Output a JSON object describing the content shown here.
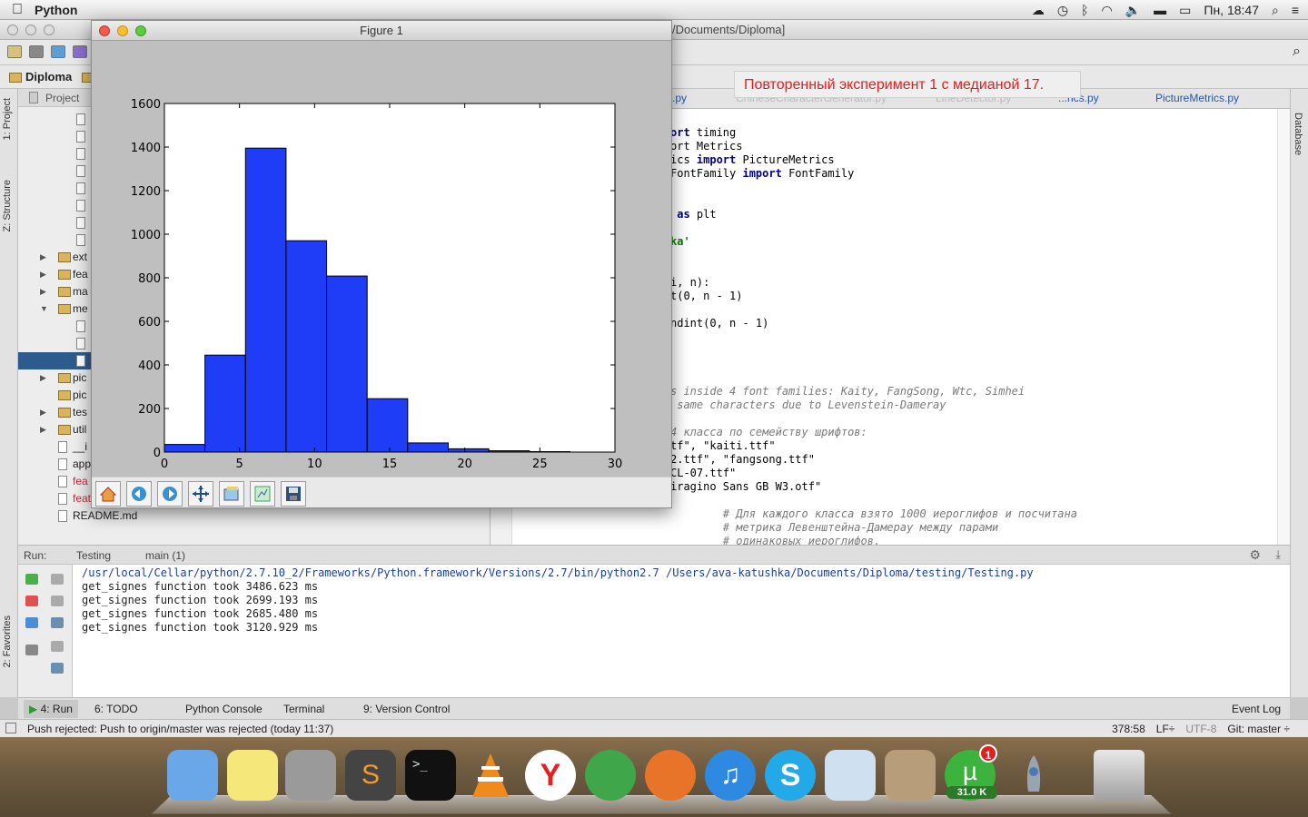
{
  "menubar": {
    "app": "Python",
    "clock": "Пн, 18:47"
  },
  "ide": {
    "path": "/Documents/Diploma]",
    "project_name": "Diploma",
    "project_tab": "Project",
    "left_tabs": [
      "1: Project",
      "Z: Structure",
      "2: Favorites"
    ],
    "right_tab": "Database"
  },
  "tooltip": "Повторенный эксперимент 1 с медианой 17.",
  "tree": [
    {
      "kind": "file",
      "label": "",
      "indent": 3
    },
    {
      "kind": "file",
      "label": "",
      "indent": 3
    },
    {
      "kind": "file",
      "label": "",
      "indent": 3
    },
    {
      "kind": "file",
      "label": "",
      "indent": 3
    },
    {
      "kind": "file",
      "label": "",
      "indent": 3
    },
    {
      "kind": "file",
      "label": "",
      "indent": 3
    },
    {
      "kind": "file",
      "label": "",
      "indent": 3
    },
    {
      "kind": "file",
      "label": "",
      "indent": 3
    },
    {
      "kind": "folder",
      "label": "ext",
      "arrow": "▶"
    },
    {
      "kind": "folder",
      "label": "fea",
      "arrow": "▶"
    },
    {
      "kind": "folder",
      "label": "ma",
      "arrow": "▶"
    },
    {
      "kind": "folder",
      "label": "me",
      "arrow": "▼"
    },
    {
      "kind": "file",
      "label": "",
      "indent": 3
    },
    {
      "kind": "file",
      "label": "",
      "indent": 3
    },
    {
      "kind": "file",
      "label": "",
      "indent": 3,
      "selected": true
    },
    {
      "kind": "folder",
      "label": "pic",
      "arrow": "▶"
    },
    {
      "kind": "folder",
      "label": "pic"
    },
    {
      "kind": "folder",
      "label": "tes",
      "arrow": "▶"
    },
    {
      "kind": "folder",
      "label": "util",
      "arrow": "▶"
    },
    {
      "kind": "file",
      "label": "__i"
    },
    {
      "kind": "file",
      "label": "app"
    },
    {
      "kind": "file",
      "label": "fea",
      "red": true
    },
    {
      "kind": "file",
      "label": "features_extractionpartSetFeatures.txt",
      "red": true
    },
    {
      "kind": "file",
      "label": "README.md"
    }
  ],
  "editor_tabs": [
    ".py",
    "ChineseCharacterGenerator.py",
    "LineDetector.py",
    "...rics.py",
    "PictureMetrics.py"
  ],
  "code_lines": [
    {
      "parts": [
        {
          "t": "ort",
          "c": "kw"
        },
        {
          "t": " timing"
        }
      ]
    },
    {
      "parts": [
        {
          "t": "ort Metrics"
        }
      ]
    },
    {
      "parts": [
        {
          "t": "ics "
        },
        {
          "t": "import",
          "c": "kw"
        },
        {
          "t": " PictureMetrics"
        }
      ]
    },
    {
      "parts": [
        {
          "t": "FontFamily "
        },
        {
          "t": "import",
          "c": "kw"
        },
        {
          "t": " FontFamily"
        }
      ]
    },
    {
      "parts": []
    },
    {
      "parts": []
    },
    {
      "parts": [
        {
          "t": " as",
          "c": "kw"
        },
        {
          "t": " plt"
        }
      ]
    },
    {
      "parts": []
    },
    {
      "parts": [
        {
          "t": "ka'",
          "c": "str"
        }
      ]
    },
    {
      "parts": []
    },
    {
      "parts": []
    },
    {
      "parts": [
        {
          "t": "i, n):"
        }
      ]
    },
    {
      "parts": [
        {
          "t": "t(0, n - 1)"
        }
      ]
    },
    {
      "parts": []
    },
    {
      "parts": [
        {
          "t": "ndint(0, n - 1)"
        }
      ]
    },
    {
      "parts": []
    },
    {
      "parts": []
    },
    {
      "parts": []
    },
    {
      "parts": []
    },
    {
      "parts": [
        {
          "t": "s inside 4 font families: Kaity, FangSong, Wtc, Simhei",
          "c": "cm"
        }
      ]
    },
    {
      "parts": [
        {
          "t": " same characters due to Levenstein-Dameray",
          "c": "cm"
        }
      ]
    },
    {
      "parts": []
    },
    {
      "parts": [
        {
          "t": "4 класса по семейству шрифтов:",
          "c": "cm"
        }
      ]
    },
    {
      "parts": [
        {
          "t": "tf\", \"kaiti.ttf\""
        }
      ]
    },
    {
      "parts": [
        {
          "t": "2.ttf\", \"fangsong.ttf\""
        }
      ]
    },
    {
      "parts": [
        {
          "t": "CL-07.ttf\""
        }
      ]
    },
    {
      "parts": [
        {
          "t": "iragino Sans GB W3.otf\""
        }
      ]
    },
    {
      "parts": []
    },
    {
      "parts": [
        {
          "t": "        # Для каждого класса взято 1000 иероглифов и посчитана",
          "c": "cm"
        }
      ]
    },
    {
      "parts": [
        {
          "t": "        # метрика Левенштейна-Дамерау между парами",
          "c": "cm"
        }
      ]
    },
    {
      "parts": [
        {
          "t": "        # одинаковых иероглифов.",
          "c": "cm"
        }
      ]
    }
  ],
  "run": {
    "label": "Run:",
    "tabs": [
      "Testing",
      "main (1)"
    ],
    "console": [
      "/usr/local/Cellar/python/2.7.10_2/Frameworks/Python.framework/Versions/2.7/bin/python2.7 /Users/ava-katushka/Documents/Diploma/testing/Testing.py",
      "get_signes function took 3486.623 ms",
      "get_signes function took 2699.193 ms",
      "get_signes function took 2685.480 ms",
      "get_signes function took 3120.929 ms"
    ]
  },
  "bottom_tabs": [
    "4: Run",
    "6: TODO",
    "Python Console",
    "Terminal",
    "9: Version Control"
  ],
  "event_log": "Event Log",
  "status": {
    "message": "Push rejected: Push to origin/master was rejected (today 11:37)",
    "position": "378:58",
    "line_sep": "LF÷",
    "encoding": "UTF-8",
    "git": "Git: master ÷"
  },
  "dock": {
    "badge": "1",
    "utorrent_speed": "31.0 K"
  },
  "figure": {
    "title": "Figure 1",
    "toolbar_icons": [
      "home-icon",
      "back-icon",
      "forward-icon",
      "pan-icon",
      "zoom-icon",
      "subplots-icon",
      "save-icon"
    ]
  },
  "chart_data": {
    "type": "bar",
    "bins": [
      0,
      2.7,
      5.4,
      8.1,
      10.8,
      13.5,
      16.2,
      18.9,
      21.6,
      24.3,
      27.0
    ],
    "values": [
      35,
      445,
      1395,
      970,
      808,
      245,
      42,
      15,
      6,
      2
    ],
    "xlim": [
      0,
      30
    ],
    "ylim": [
      0,
      1600
    ],
    "xticks": [
      0,
      5,
      10,
      15,
      20,
      25,
      30
    ],
    "yticks": [
      0,
      200,
      400,
      600,
      800,
      1000,
      1200,
      1400,
      1600
    ],
    "bar_color": "#1f3cf7",
    "title": "",
    "xlabel": "",
    "ylabel": ""
  }
}
